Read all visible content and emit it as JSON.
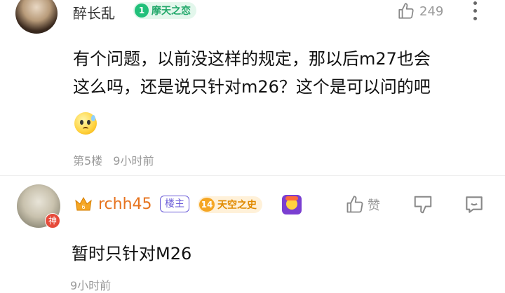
{
  "comments": [
    {
      "username": "醉长乱",
      "level": "1",
      "level_title": "摩天之恋",
      "like_count": "249",
      "text_line1": "有个问题，以前没这样的规定，那以后m27也会",
      "text_line2": "这么吗，还是说只针对m26？这个是可以问的吧",
      "floor": "第5楼",
      "time": "9小时前"
    },
    {
      "username": "rchh45",
      "badge_host": "楼主",
      "level": "14",
      "level_title": "天空之史",
      "avatar_badge": "神",
      "like_label": "赞",
      "text": "暂时只针对M26",
      "time": "9小时前"
    }
  ],
  "colors": {
    "level_green": "#21c07a",
    "level_orange": "#f5a623",
    "username_orange": "#e6731e",
    "host_purple": "#6a5bd8"
  }
}
